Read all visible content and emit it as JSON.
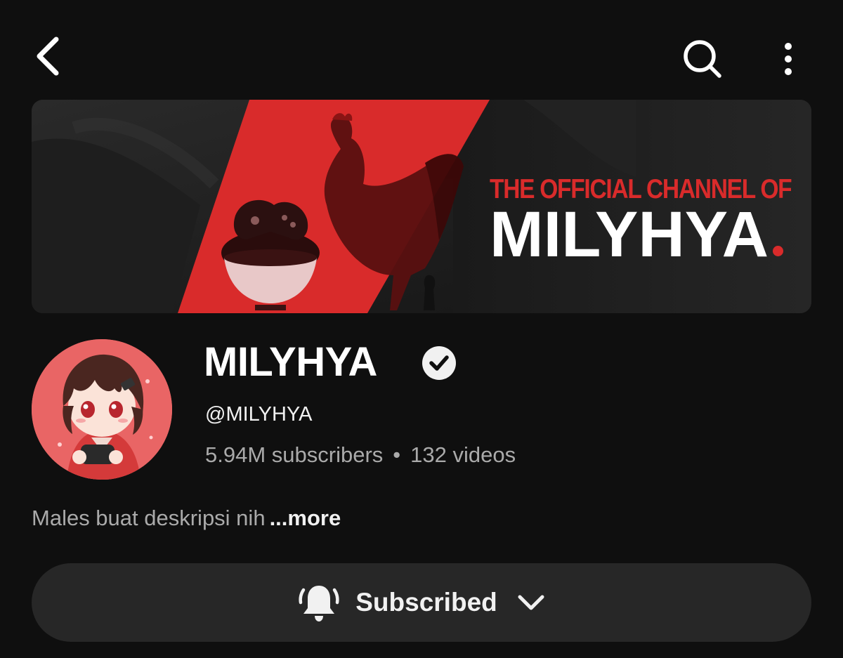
{
  "topbar": {
    "back_icon": "chevron-left-icon",
    "search_icon": "search-icon",
    "more_icon": "more-vertical-icon"
  },
  "banner": {
    "kicker": "THE OFFICIAL CHANNEL OF",
    "title": "MILYHYA",
    "accent_color": "#d92b2b"
  },
  "channel": {
    "name": "MILYHYA",
    "verified_icon": "verified-check-icon",
    "handle": "@MILYHYA",
    "subscribers": "5.94M subscribers",
    "separator": "•",
    "videos": "132 videos",
    "description": "Males buat deskripsi nih",
    "more_label": "...more"
  },
  "subscribe_button": {
    "label": "Subscribed",
    "bell_icon": "bell-all-notifications-icon",
    "dropdown_icon": "chevron-down-icon"
  }
}
